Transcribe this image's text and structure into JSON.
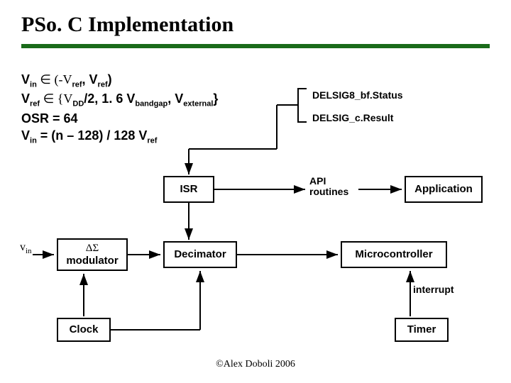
{
  "title": "PSo. C Implementation",
  "params": {
    "line1_pre": "V",
    "line1_sub1": "in",
    "line1_mid": " ∈ (-V",
    "line1_sub2": "ref",
    "line1_mid2": ", V",
    "line1_sub3": "ref",
    "line1_end": ")",
    "line2_pre": "V",
    "line2_sub1": "ref",
    "line2_mid": " ∈ {V",
    "line2_sub2": "DD",
    "line2_mid2": "/2, 1. 6 V",
    "line2_sub3": "bandgap",
    "line2_mid3": ", V",
    "line2_sub4": "external",
    "line2_end": "}",
    "line3": "OSR = 64",
    "line4_pre": "V",
    "line4_sub1": "in",
    "line4_mid": " = (n – 128) / 128 V",
    "line4_sub2": "ref"
  },
  "labels": {
    "delsig_status": "DELSIG8_bf.Status",
    "delsig_result": "DELSIG_c.Result",
    "api": "API\nroutines",
    "interrupt": "interrupt",
    "vin": "v",
    "vin_sub": "in"
  },
  "boxes": {
    "isr": "ISR",
    "application": "Application",
    "modulator_top": "ΔΣ",
    "modulator_bot": "modulator",
    "decimator": "Decimator",
    "microcontroller": "Microcontroller",
    "clock": "Clock",
    "timer": "Timer"
  },
  "footer": "©Alex Doboli 2006"
}
